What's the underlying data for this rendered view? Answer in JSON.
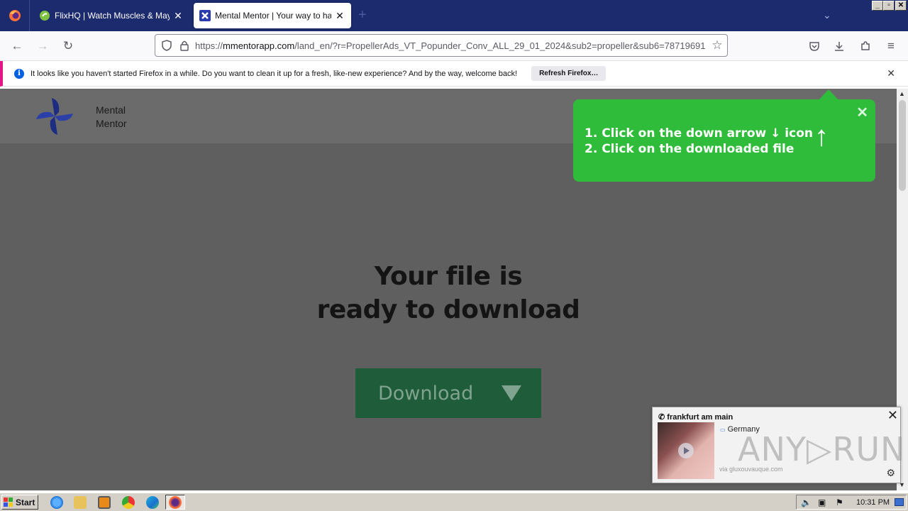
{
  "browser": {
    "tabs": [
      {
        "title": "FlixHQ | Watch Muscles & Mayhem",
        "close": "✕",
        "active": false
      },
      {
        "title": "Mental Mentor | Your way to harmony",
        "close": "✕",
        "active": true
      }
    ],
    "new_tab": "+",
    "url_prefix": "https://",
    "url_host": "mmentorapp.com",
    "url_path": "/land_en/?r=PropellerAds_VT_Popunder_Conv_ALL_29_01_2024&sub2=propeller&sub6=78719691",
    "notification": {
      "text": "It looks like you haven't started Firefox in a while. Do you want to clean it up for a fresh, like-new experience? And by the way, welcome back!",
      "button": "Refresh Firefox…",
      "close": "✕",
      "info": "i"
    },
    "window_controls": [
      "_",
      "▫",
      "✕"
    ]
  },
  "site": {
    "brand_line1": "Mental",
    "brand_line2": "Mentor",
    "headline_line1": "Your file is",
    "headline_line2": "ready to download",
    "download_label": "Download"
  },
  "hint": {
    "line1": "1. Click on the down arrow ↓ icon",
    "line2": "2. Click on the downloaded file",
    "close": "✕",
    "arrow": "↑"
  },
  "ad": {
    "location": "frankfurt am main",
    "country": "Germany",
    "via": "via gluxouvauque.com",
    "close": "✕",
    "watermark": "ANY▷RUN"
  },
  "taskbar": {
    "start": "Start",
    "clock": "10:31 PM"
  },
  "colors": {
    "tabstrip": "#1c2a6e",
    "hint_green": "#2fbc3a",
    "download_green": "#1f5c3a",
    "page_overlay": "#5f5f5f"
  }
}
